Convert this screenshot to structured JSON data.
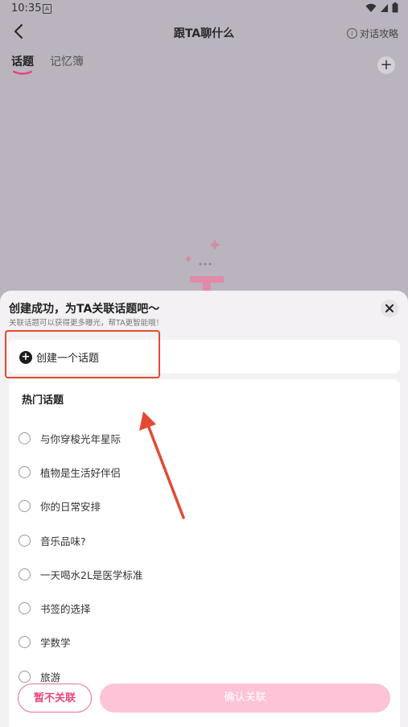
{
  "status_bar": {
    "time": "10:35",
    "badge": "A"
  },
  "header": {
    "title": "跟TA聊什么",
    "guide_label": "对话攻略"
  },
  "tabs": [
    {
      "label": "话题"
    },
    {
      "label": "记忆簿"
    }
  ],
  "sheet": {
    "title": "创建成功，为TA关联话题吧～",
    "subtitle": "关联话题可以获得更多曝光，帮TA更智能哦！",
    "create_label": "创建一个话题",
    "hot_title": "热门话题",
    "topics": [
      {
        "label": "与你穿梭光年星际"
      },
      {
        "label": "植物是生活好伴侣"
      },
      {
        "label": "你的日常安排"
      },
      {
        "label": "音乐品味?"
      },
      {
        "label": "一天喝水2L是医学标准"
      },
      {
        "label": "书签的选择"
      },
      {
        "label": "学数学"
      },
      {
        "label": "旅游"
      }
    ],
    "skip_label": "暂不关联",
    "confirm_label": "确认关联"
  },
  "colors": {
    "accent_pink": "#e8457f",
    "annotation_red": "#e24a34"
  }
}
